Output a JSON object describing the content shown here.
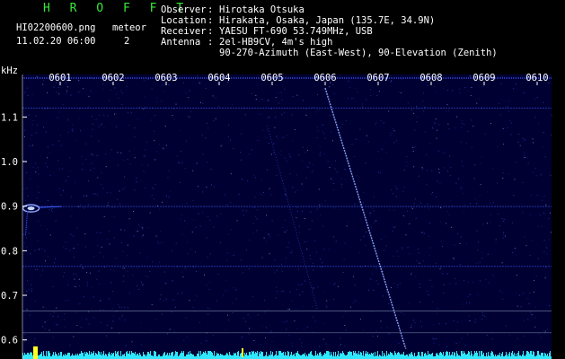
{
  "header": {
    "brand": "H R O F F T",
    "filename": "HI02200600.png",
    "datetime": "11.02.20 06:00",
    "meteor_label": "meteor",
    "meteor_count": "2",
    "info": [
      {
        "key": "Observer",
        "value": "Hirotaka Otsuka"
      },
      {
        "key": "Location",
        "value": "Hirakata, Osaka, Japan (135.7E, 34.9N)"
      },
      {
        "key": "Receiver",
        "value": "YAESU FT-690 53.749MHz, USB"
      },
      {
        "key": "Antenna",
        "value": "2el-HB9CV, 4m's high"
      }
    ],
    "antenna_line2": "90-270-Azimuth (East-West), 90-Elevation (Zenith)"
  },
  "chart_data": {
    "type": "heatmap",
    "title": "",
    "ylabel": "kHz",
    "xlabel": "",
    "x_ticks": [
      "0601",
      "0602",
      "0603",
      "0604",
      "0605",
      "0606",
      "0607",
      "0608",
      "0609",
      "0610"
    ],
    "x_range": [
      "0600",
      "0610"
    ],
    "y_ticks": [
      0.6,
      0.7,
      0.8,
      0.9,
      1.0,
      1.1
    ],
    "ylim": [
      0.58,
      1.18
    ],
    "background_color": "#000033",
    "signal_color": "#4060ff",
    "trace_color": "#8fa8ff",
    "horizontal_interference_khz": [
      1.12,
      0.899,
      0.765,
      0.665,
      0.616
    ],
    "meteor_trails": [
      {
        "x_start": 6.0,
        "y_start": 1.165,
        "x_end": 7.52,
        "y_end": 0.58
      },
      {
        "x_start": 4.91,
        "y_start": 1.08,
        "x_end": 5.85,
        "y_end": 0.67
      }
    ],
    "meteor_echo": {
      "x": 0.45,
      "y": 0.895
    },
    "baseline_color": "#2fe8ff",
    "marker_color": "#ffff20"
  }
}
